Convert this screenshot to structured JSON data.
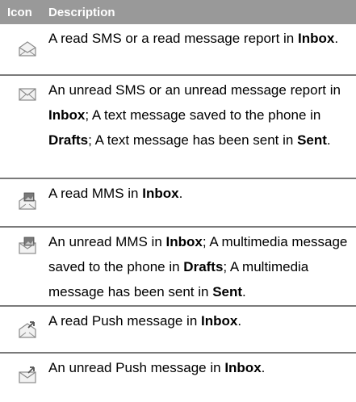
{
  "header": {
    "icon": "Icon",
    "description": "Description"
  },
  "rows": [
    {
      "icon": "read-sms-envelope-icon",
      "parts": [
        [
          "A read SMS or a read message report in ",
          false
        ],
        [
          "Inbox",
          true
        ],
        [
          ".",
          false
        ]
      ]
    },
    {
      "icon": "unread-sms-envelope-icon",
      "parts": [
        [
          "An unread SMS or an unread message report in ",
          false
        ],
        [
          "Inbox",
          true
        ],
        [
          "; A text message saved to the phone in ",
          false
        ],
        [
          "Drafts",
          true
        ],
        [
          "; A text message has been sent in ",
          false
        ],
        [
          "Sent",
          true
        ],
        [
          ".",
          false
        ]
      ]
    },
    {
      "icon": "read-mms-envelope-icon",
      "parts": [
        [
          "A read MMS in ",
          false
        ],
        [
          "Inbox",
          true
        ],
        [
          ".",
          false
        ]
      ]
    },
    {
      "icon": "unread-mms-envelope-icon",
      "parts": [
        [
          "An unread MMS in ",
          false
        ],
        [
          "Inbox",
          true
        ],
        [
          "; A multimedia message saved to the phone in ",
          false
        ],
        [
          "Drafts",
          true
        ],
        [
          "; A multimedia message has been sent in ",
          false
        ],
        [
          "Sent",
          true
        ],
        [
          ".",
          false
        ]
      ]
    },
    {
      "icon": "read-push-envelope-icon",
      "parts": [
        [
          "A read Push message in ",
          false
        ],
        [
          "Inbox",
          true
        ],
        [
          ".",
          false
        ]
      ]
    },
    {
      "icon": "unread-push-envelope-icon",
      "parts": [
        [
          "An unread Push message in ",
          false
        ],
        [
          "Inbox",
          true
        ],
        [
          ".",
          false
        ]
      ]
    }
  ]
}
